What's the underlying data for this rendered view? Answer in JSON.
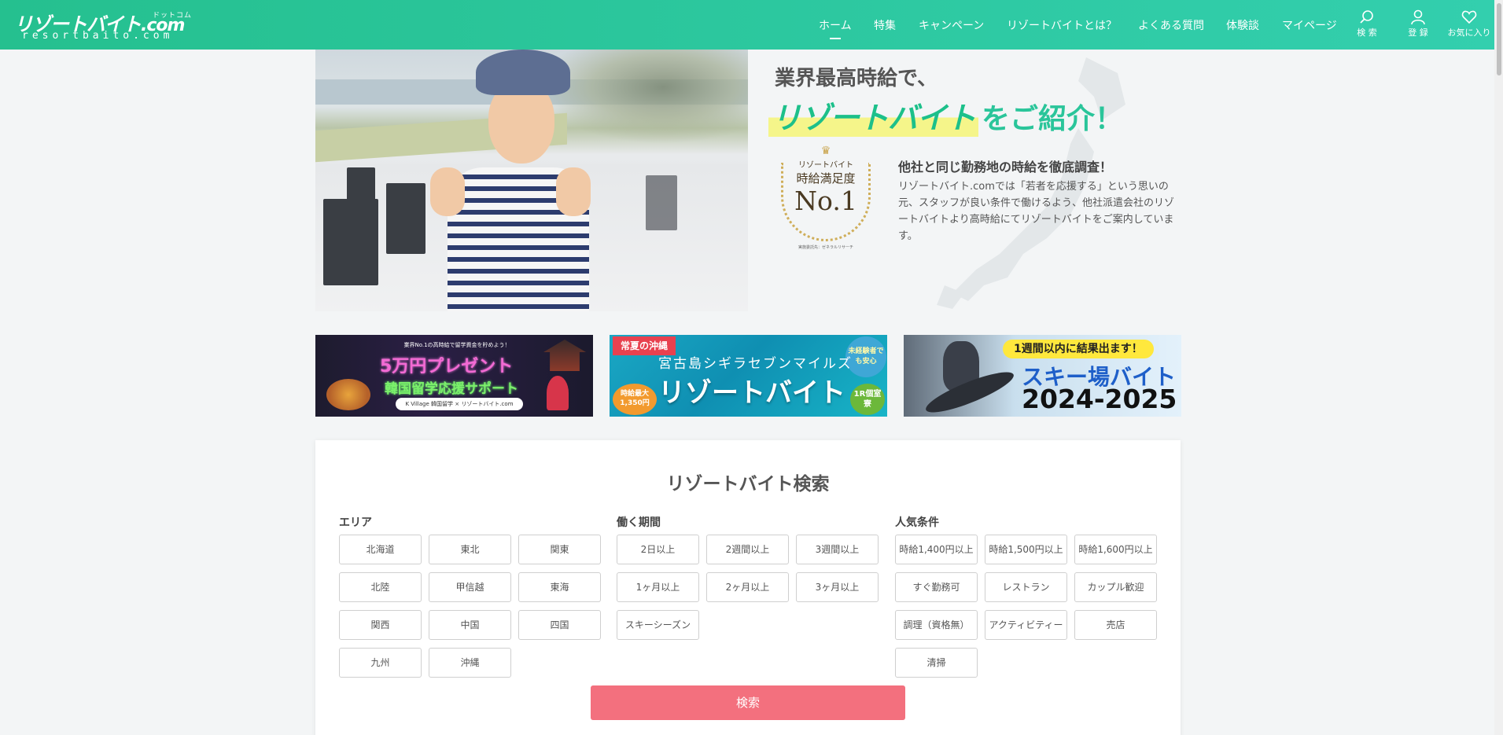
{
  "header": {
    "logo_text": "リゾートバイト",
    "logo_com": ".com",
    "logo_kana": "ドットコム",
    "logo_domain": "resortbaito.com",
    "nav": [
      "ホーム",
      "特集",
      "キャンペーン",
      "リゾートバイトとは？",
      "よくある質問",
      "体験談",
      "マイページ"
    ],
    "active_nav": "ホーム",
    "icons": [
      {
        "name": "search-icon",
        "label": "検 索"
      },
      {
        "name": "user-icon",
        "label": "登 録"
      },
      {
        "name": "heart-icon",
        "label": "お気に入り"
      }
    ],
    "colors": {
      "gradient_start": "#25c08f",
      "gradient_end": "#33cfae"
    }
  },
  "hero": {
    "line1": "業界最高時給で、",
    "logo": "リゾートバイト",
    "suffix": "をご紹介！",
    "badge": {
      "line1": "リゾートバイト",
      "line2": "時給満足度",
      "line3": "No.1",
      "note": "実施委託先：ゼネラルリサーチ"
    },
    "heading": "他社と同じ勤務地の時給を徹底調査！",
    "description": "リゾートバイト.comでは「若者を応援する」という思いの元、スタッフが良い条件で働けるよう、他社派遣会社のリゾートバイトより高時給にてリゾートバイトをご案内しています。"
  },
  "banners": {
    "b1": {
      "small": "業界No.1の高時給で留学資金を貯めよう！",
      "big": "5万円プレゼント",
      "mid": "韓国留学応援サポート",
      "pill": "K Village 韓国留学 × リゾートバイト.com"
    },
    "b2": {
      "tag": "常夏の沖縄",
      "circle": "未経験者でも安心",
      "place": "宮古島シギラセブンマイルズ",
      "big": "リゾートバイト",
      "wage": "時給最大1,350円",
      "room": "1R個室寮"
    },
    "b3": {
      "tag": "1週間以内に結果出ます！",
      "big1": "スキー場バイト",
      "big2": "2024-2025"
    }
  },
  "search": {
    "title": "リゾートバイト検索",
    "area_title": "エリア",
    "area": [
      "北海道",
      "東北",
      "関東",
      "北陸",
      "甲信越",
      "東海",
      "関西",
      "中国",
      "四国",
      "九州",
      "沖縄"
    ],
    "period_title": "働く期間",
    "period": [
      "2日以上",
      "2週間以上",
      "3週間以上",
      "1ヶ月以上",
      "2ヶ月以上",
      "3ヶ月以上",
      "スキーシーズン"
    ],
    "popular_title": "人気条件",
    "popular": [
      "時給1,400円以上",
      "時給1,500円以上",
      "時給1,600円以上",
      "すぐ勤務可",
      "レストラン",
      "カップル歓迎",
      "調理（資格無）",
      "アクティビティー",
      "売店",
      "清掃"
    ],
    "button": "検索",
    "button_color": "#f3707e"
  }
}
